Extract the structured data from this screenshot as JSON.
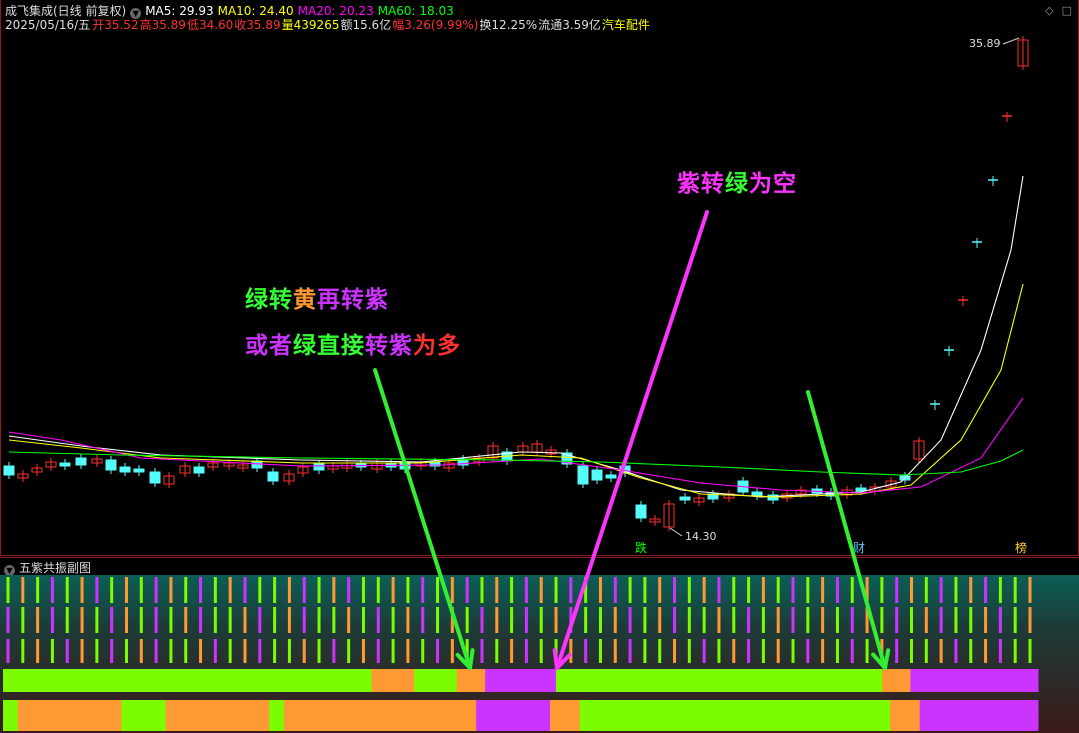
{
  "header": {
    "stock_name": "成飞集成(日线 前复权)",
    "ma5": "MA5: 29.93",
    "ma10": "MA10: 24.40",
    "ma20": "MA20: 20.23",
    "ma60": "MA60: 18.03",
    "date": "2025/05/16/五",
    "open": "开35.52",
    "high": "高35.89",
    "low": "低34.60",
    "close": "收35.89",
    "volume": "量439265",
    "amount": "额15.6亿",
    "change": "幅3.26(9.99%)",
    "turnover": "换12.25%",
    "float": "流通3.59亿",
    "sector": "汽车配件"
  },
  "chart_labels": {
    "high_price": "35.89",
    "low_price": "14.30",
    "marker_die": "跌",
    "marker_cai": "财",
    "marker_bang": "榜"
  },
  "annotations": {
    "line1_a": "绿转",
    "line1_b": "黄",
    "line1_c": "再转紫",
    "line2_a": "或者",
    "line2_b": "绿直接",
    "line2_c": "转紫",
    "line2_d": "为多",
    "top_a": "紫转",
    "top_b": "绿",
    "top_c": "为空"
  },
  "sub_panel": {
    "title": "五紫共振副图"
  },
  "colors": {
    "up": "#ff3030",
    "down": "#54fcfc",
    "ma5": "#ffffff",
    "ma10": "#ffff00",
    "ma20": "#ff00ff",
    "ma60": "#00ff00",
    "green": "#7cfc00",
    "orange": "#ff9933",
    "purple": "#cc33ff"
  },
  "chart_data": {
    "type": "candlestick",
    "period": "daily",
    "price_range": [
      14.3,
      35.89
    ],
    "last_close": 35.89,
    "band_row1": [
      {
        "color": "green",
        "len": 26
      },
      {
        "color": "orange",
        "len": 3
      },
      {
        "color": "green",
        "len": 3
      },
      {
        "color": "orange",
        "len": 2
      },
      {
        "color": "purple",
        "len": 5
      },
      {
        "color": "green",
        "len": 23
      },
      {
        "color": "orange",
        "len": 2
      },
      {
        "color": "purple",
        "len": 9
      }
    ],
    "band_row2": [
      {
        "color": "green",
        "len": 1
      },
      {
        "color": "orange",
        "len": 7
      },
      {
        "color": "green",
        "len": 3
      },
      {
        "color": "orange",
        "len": 7
      },
      {
        "color": "green",
        "len": 1
      },
      {
        "color": "orange",
        "len": 13
      },
      {
        "color": "purple",
        "len": 5
      },
      {
        "color": "orange",
        "len": 2
      },
      {
        "color": "green",
        "len": 21
      },
      {
        "color": "orange",
        "len": 2
      },
      {
        "color": "purple",
        "len": 8
      }
    ]
  }
}
